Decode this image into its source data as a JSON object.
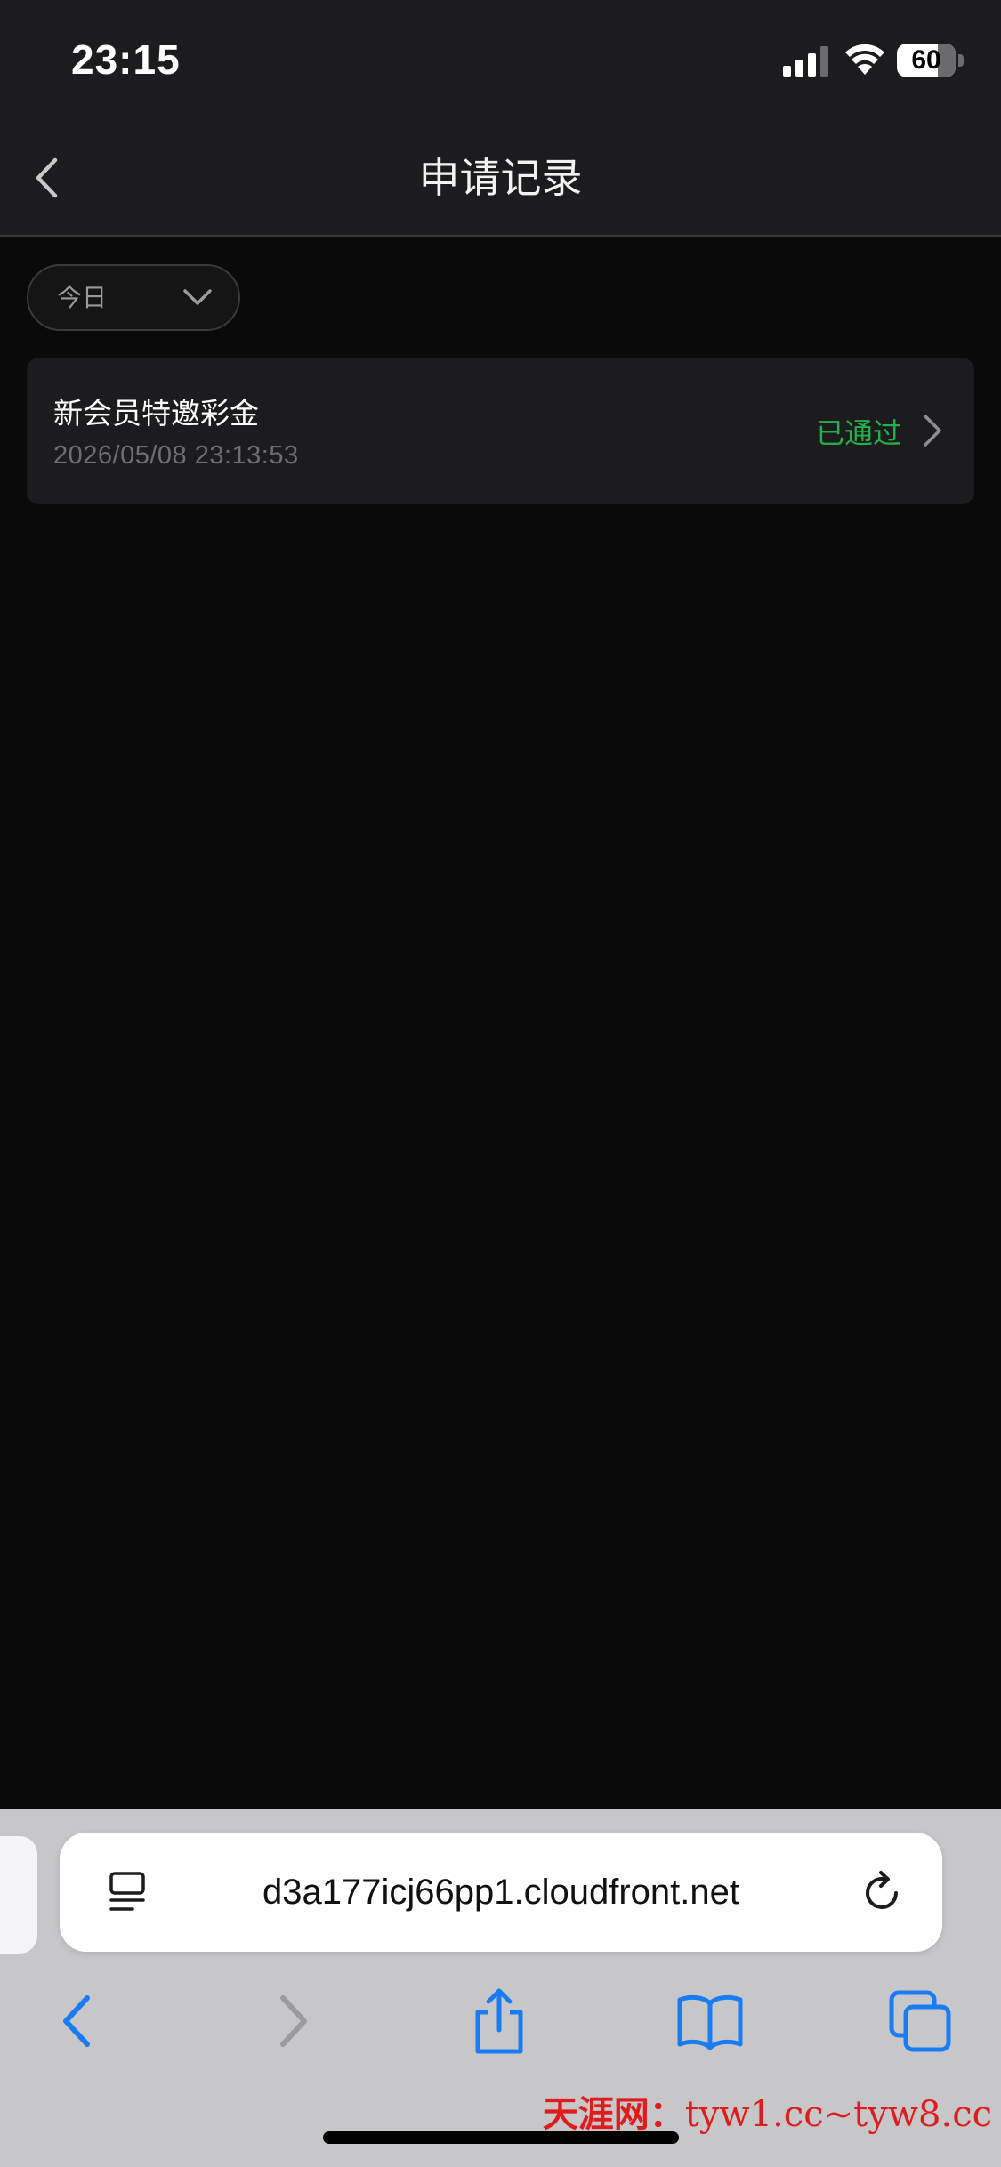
{
  "status_bar": {
    "time": "23:15",
    "battery": "60",
    "icons": [
      "signal-icon",
      "wifi-icon",
      "battery-icon"
    ]
  },
  "header": {
    "title": "申请记录",
    "back_icon": "chevron-left-icon"
  },
  "filter": {
    "selected": "今日",
    "icon": "chevron-down-icon"
  },
  "records": [
    {
      "title": "新会员特邀彩金",
      "datetime": "2026/05/08 23:13:53",
      "status": "已通过",
      "status_color": "#21b04b"
    }
  ],
  "browser": {
    "url": "d3a177icj66pp1.cloudfront.net",
    "icons": {
      "reader": "reader-mode-icon",
      "reload": "reload-icon",
      "back": "back-arrow-icon",
      "forward": "forward-arrow-icon",
      "share": "share-icon",
      "bookmarks": "bookmarks-icon",
      "tabs": "tabs-icon"
    },
    "accent": "#1a7cf5"
  },
  "watermark": {
    "brand": "天涯网：",
    "domains": "tyw1.cc~tyw8.cc"
  },
  "colors": {
    "background": "#0a0a0a",
    "header": "#1c1c1e",
    "card": "#1c1c1e"
  }
}
